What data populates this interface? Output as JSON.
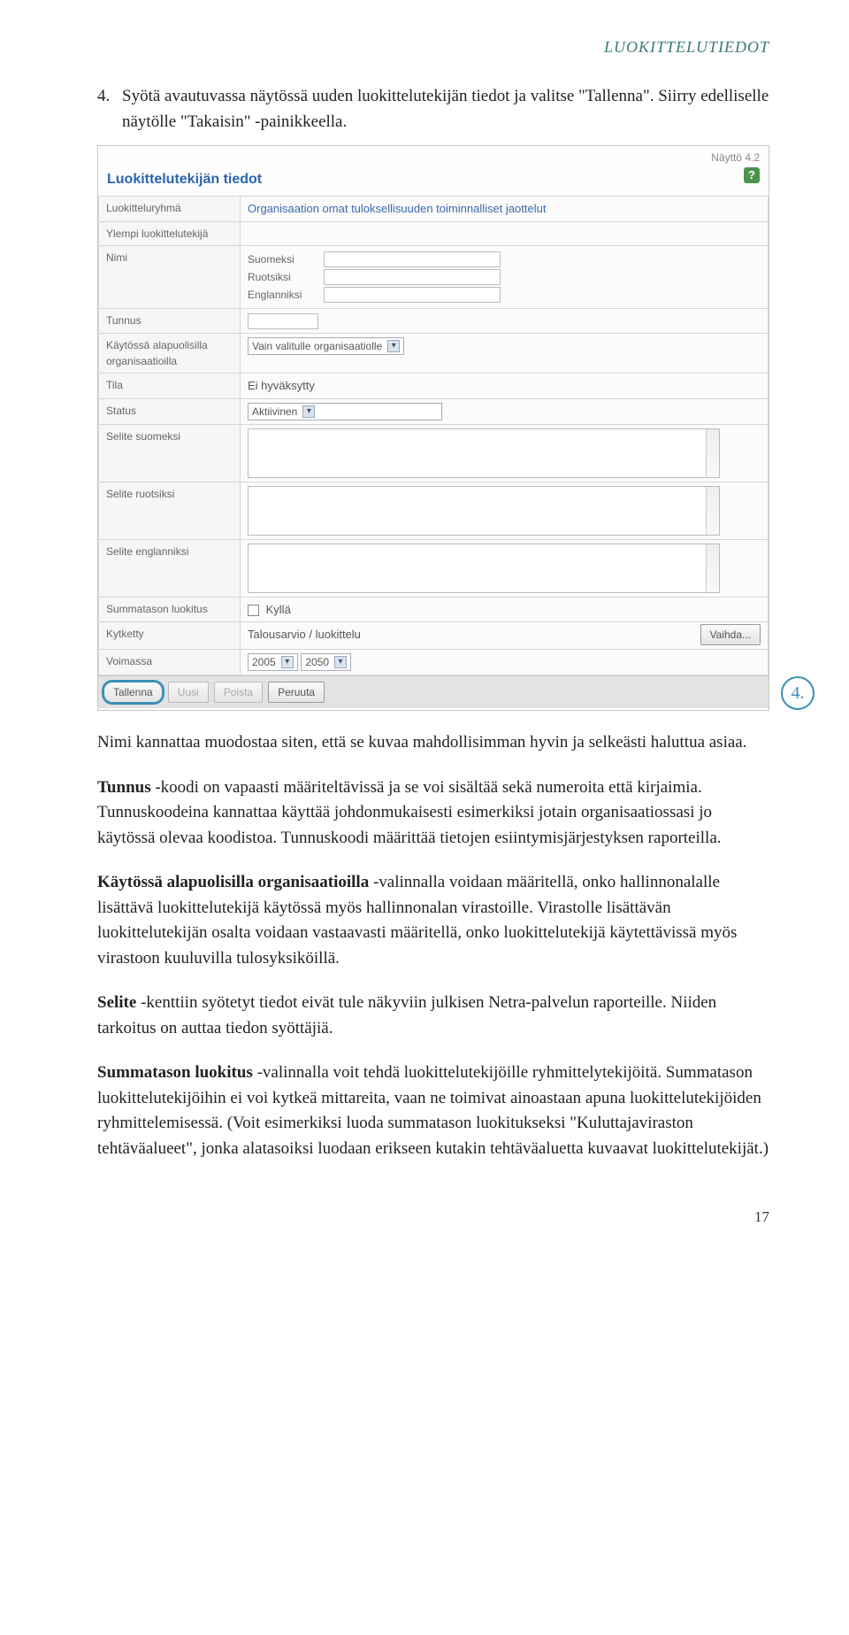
{
  "header": {
    "section_label": "LUOKITTELUTIEDOT"
  },
  "intro": {
    "number": "4.",
    "text": "Syötä avautuvassa näytössä uuden luokittelutekijän tiedot ja valitse \"Tallenna\". Siirry edelliselle näytölle \"Takaisin\" -painikkeella."
  },
  "screenshot": {
    "top_label": "Näyttö 4.2",
    "title": "Luokittelutekijän tiedot",
    "help": "?",
    "rows": {
      "luokitteluryhma": {
        "label": "Luokitteluryhmä",
        "value": "Organisaation omat tuloksellisuuden toiminnalliset jaottelut"
      },
      "ylempi": {
        "label": "Ylempi luokittelutekijä"
      },
      "nimi": {
        "label": "Nimi",
        "suomeksi": "Suomeksi",
        "ruotsiksi": "Ruotsiksi",
        "englanniksi": "Englanniksi"
      },
      "tunnus": {
        "label": "Tunnus"
      },
      "kaytossa": {
        "label": "Käytössä alapuolisilla organisaatioilla",
        "select": "Vain valitulle organisaatiolle"
      },
      "tila": {
        "label": "Tila",
        "value": "Ei hyväksytty"
      },
      "status": {
        "label": "Status",
        "value": "Aktiivinen"
      },
      "selite_fi": {
        "label": "Selite suomeksi"
      },
      "selite_sv": {
        "label": "Selite ruotsiksi"
      },
      "selite_en": {
        "label": "Selite englanniksi"
      },
      "summataso": {
        "label": "Summatason luokitus",
        "check": "Kyllä"
      },
      "kytketty": {
        "label": "Kytketty",
        "value": "Talousarvio / luokittelu",
        "vaihda": "Vaihda..."
      },
      "voimassa": {
        "label": "Voimassa",
        "from": "2005",
        "to": "2050"
      }
    },
    "buttons": {
      "tallenna": "Tallenna",
      "uusi": "Uusi",
      "poista": "Poista",
      "peruuta": "Peruuta"
    }
  },
  "callout": "4.",
  "paragraphs": {
    "p1": "Nimi kannattaa muodostaa siten, että se kuvaa mahdollisimman hyvin ja selkeästi haluttua asiaa.",
    "p2a": "Tunnus",
    "p2b": " -koodi on vapaasti määriteltävissä ja se voi sisältää sekä numeroita että kirjaimia. Tunnuskoodeina kannattaa käyttää johdonmukaisesti esimerkiksi jotain organisaatiossasi jo käytössä olevaa koodistoa. Tunnuskoodi määrittää tietojen esiintymisjärjestyksen raporteilla.",
    "p3a": "Käytössä alapuolisilla organisaatioilla",
    "p3b": " -valinnalla voidaan määritellä, onko hallinnonalalle lisättävä luokittelutekijä käytössä myös hallinnonalan virastoille. Virastolle lisättävän luokittelutekijän osalta voidaan vastaavasti määritellä, onko luokittelutekijä käytettävissä myös virastoon kuuluvilla tulosyksiköillä.",
    "p4a": "Selite",
    "p4b": " -kenttiin syötetyt tiedot eivät tule näkyviin julkisen Netra-palvelun raporteille. Niiden tarkoitus on auttaa tiedon syöttäjiä.",
    "p5a": "Summatason luokitus",
    "p5b": " -valinnalla voit tehdä luokittelutekijöille ryhmittelytekijöitä. Summatason luokittelutekijöihin ei voi kytkeä mittareita, vaan ne toimivat ainoastaan apuna luokittelutekijöiden ryhmittelemisessä. (Voit esimerkiksi luoda summatason luokitukseksi \"Kuluttajaviraston tehtäväalueet\", jonka alatasoiksi luodaan erikseen kutakin tehtäväaluetta kuvaavat luokittelutekijät.)"
  },
  "page_number": "17"
}
